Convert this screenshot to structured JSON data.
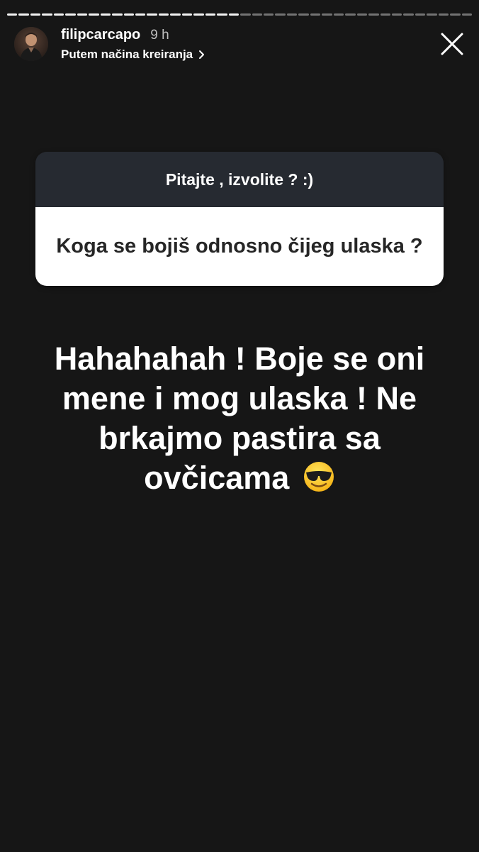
{
  "progress": {
    "segments_seen": 20,
    "segments_total": 40
  },
  "header": {
    "username": "filipcarcapo",
    "time": "9 h",
    "subline": "Putem načina kreiranja",
    "avatar_icon": "profile-avatar",
    "close_icon": "close-icon"
  },
  "question_sticker": {
    "prompt": "Pitajte , izvolite ? :)",
    "question": "Koga se bojiš odnosno čijeg ulaska ?"
  },
  "answer": {
    "text": "Hahahahah ! Boje se oni mene i mog ulaska ! Ne brkajmo pastira sa ovčicama",
    "emoji": "smiling-face-with-sunglasses"
  },
  "colors": {
    "background": "#161616",
    "sticker_header": "#262a31",
    "sticker_body": "#ffffff",
    "text": "#ffffff"
  }
}
